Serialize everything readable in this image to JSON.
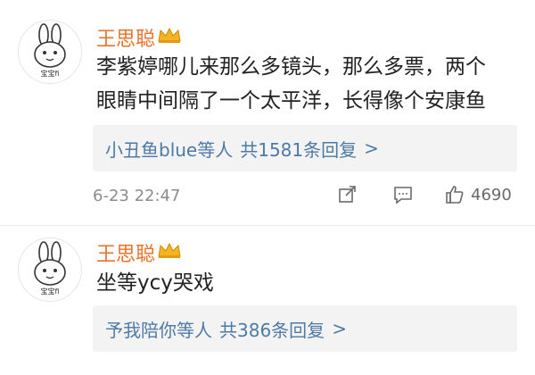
{
  "comments": [
    {
      "username": "王思聪",
      "avatar_text": "宝宝fi",
      "content_lines": [
        "李紫婷哪儿来那么多镜头，那么多票，两个",
        "眼睛中间隔了一个太平洋，长得像个安康鱼"
      ],
      "reply_preview": "小丑鱼blue等人",
      "reply_count": "共1581条回复",
      "reply_arrow": ">",
      "time": "6-23 22:47",
      "likes": "4690"
    },
    {
      "username": "王思聪",
      "avatar_text": "宝宝fi",
      "content_lines": [
        "坐等ycy哭戏"
      ],
      "reply_preview": "予我陪你等人",
      "reply_count": "共386条回复",
      "reply_arrow": ">"
    }
  ],
  "icons": {
    "crown": "crown-icon",
    "share": "share-icon",
    "comment": "comment-icon",
    "like": "thumbs-up-icon"
  },
  "colors": {
    "username": "#e8732a",
    "link": "#4d7aa6",
    "meta": "#8c8c8c"
  }
}
